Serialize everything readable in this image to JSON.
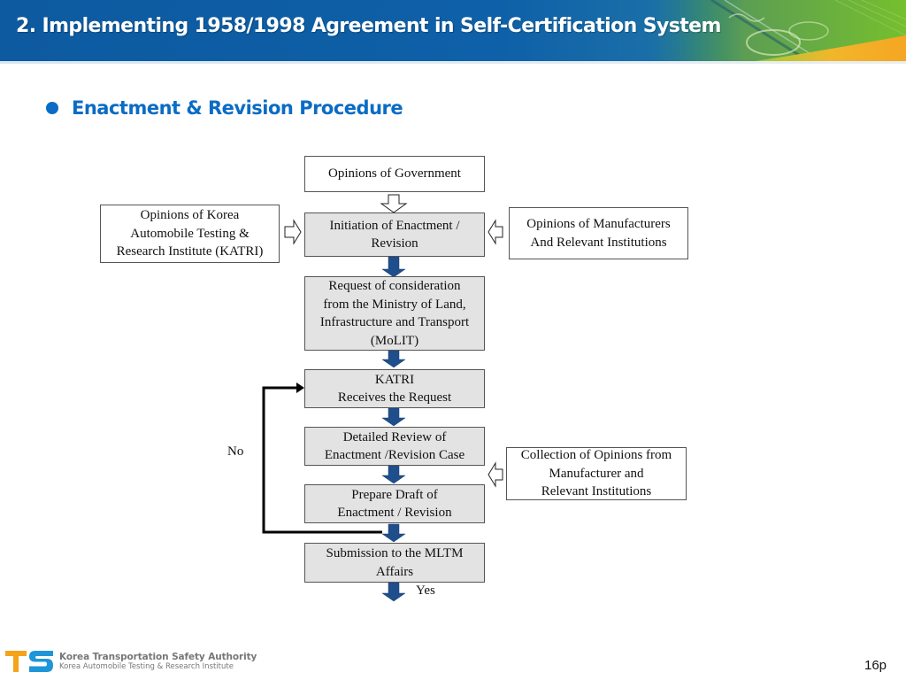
{
  "header": {
    "title": "2. Implementing 1958/1998 Agreement in Self-Certification System"
  },
  "section": {
    "bullet_icon": "filled-circle-icon",
    "title": "Enactment & Revision Procedure"
  },
  "colors": {
    "header_blue": "#0d5aa0",
    "accent_blue": "#0a6cc4",
    "process_box_fill": "#e3e3e3",
    "flow_arrow_fill": "#1f4e8c"
  },
  "flowchart": {
    "inputs": {
      "government": [
        "Opinions of Government"
      ],
      "katri": [
        "Opinions of Korea",
        "Automobile Testing &",
        "Research Institute (KATRI)"
      ],
      "manufacturers": [
        "Opinions of Manufacturers",
        "And Relevant Institutions"
      ],
      "collection": [
        "Collection of Opinions from",
        "Manufacturer and",
        "Relevant Institutions"
      ]
    },
    "steps": [
      {
        "lines": [
          "Initiation of Enactment /",
          "Revision"
        ]
      },
      {
        "lines": [
          "Request of consideration",
          "from the Ministry of Land,",
          "Infrastructure and Transport",
          "(MoLIT)"
        ]
      },
      {
        "lines": [
          "KATRI",
          "Receives the Request"
        ]
      },
      {
        "lines": [
          "Detailed Review of",
          "Enactment /Revision Case"
        ]
      },
      {
        "lines": [
          "Prepare Draft of",
          "Enactment / Revision"
        ]
      },
      {
        "lines": [
          "Submission to the MLTM",
          "Affairs"
        ]
      }
    ],
    "loop_label": "No",
    "exit_label": "Yes"
  },
  "footer": {
    "logo_text": "TS",
    "org_name": "Korea Transportation Safety Authority",
    "org_sub": "Korea  Automobile Testing &  Research  Institute",
    "page": "16p"
  }
}
